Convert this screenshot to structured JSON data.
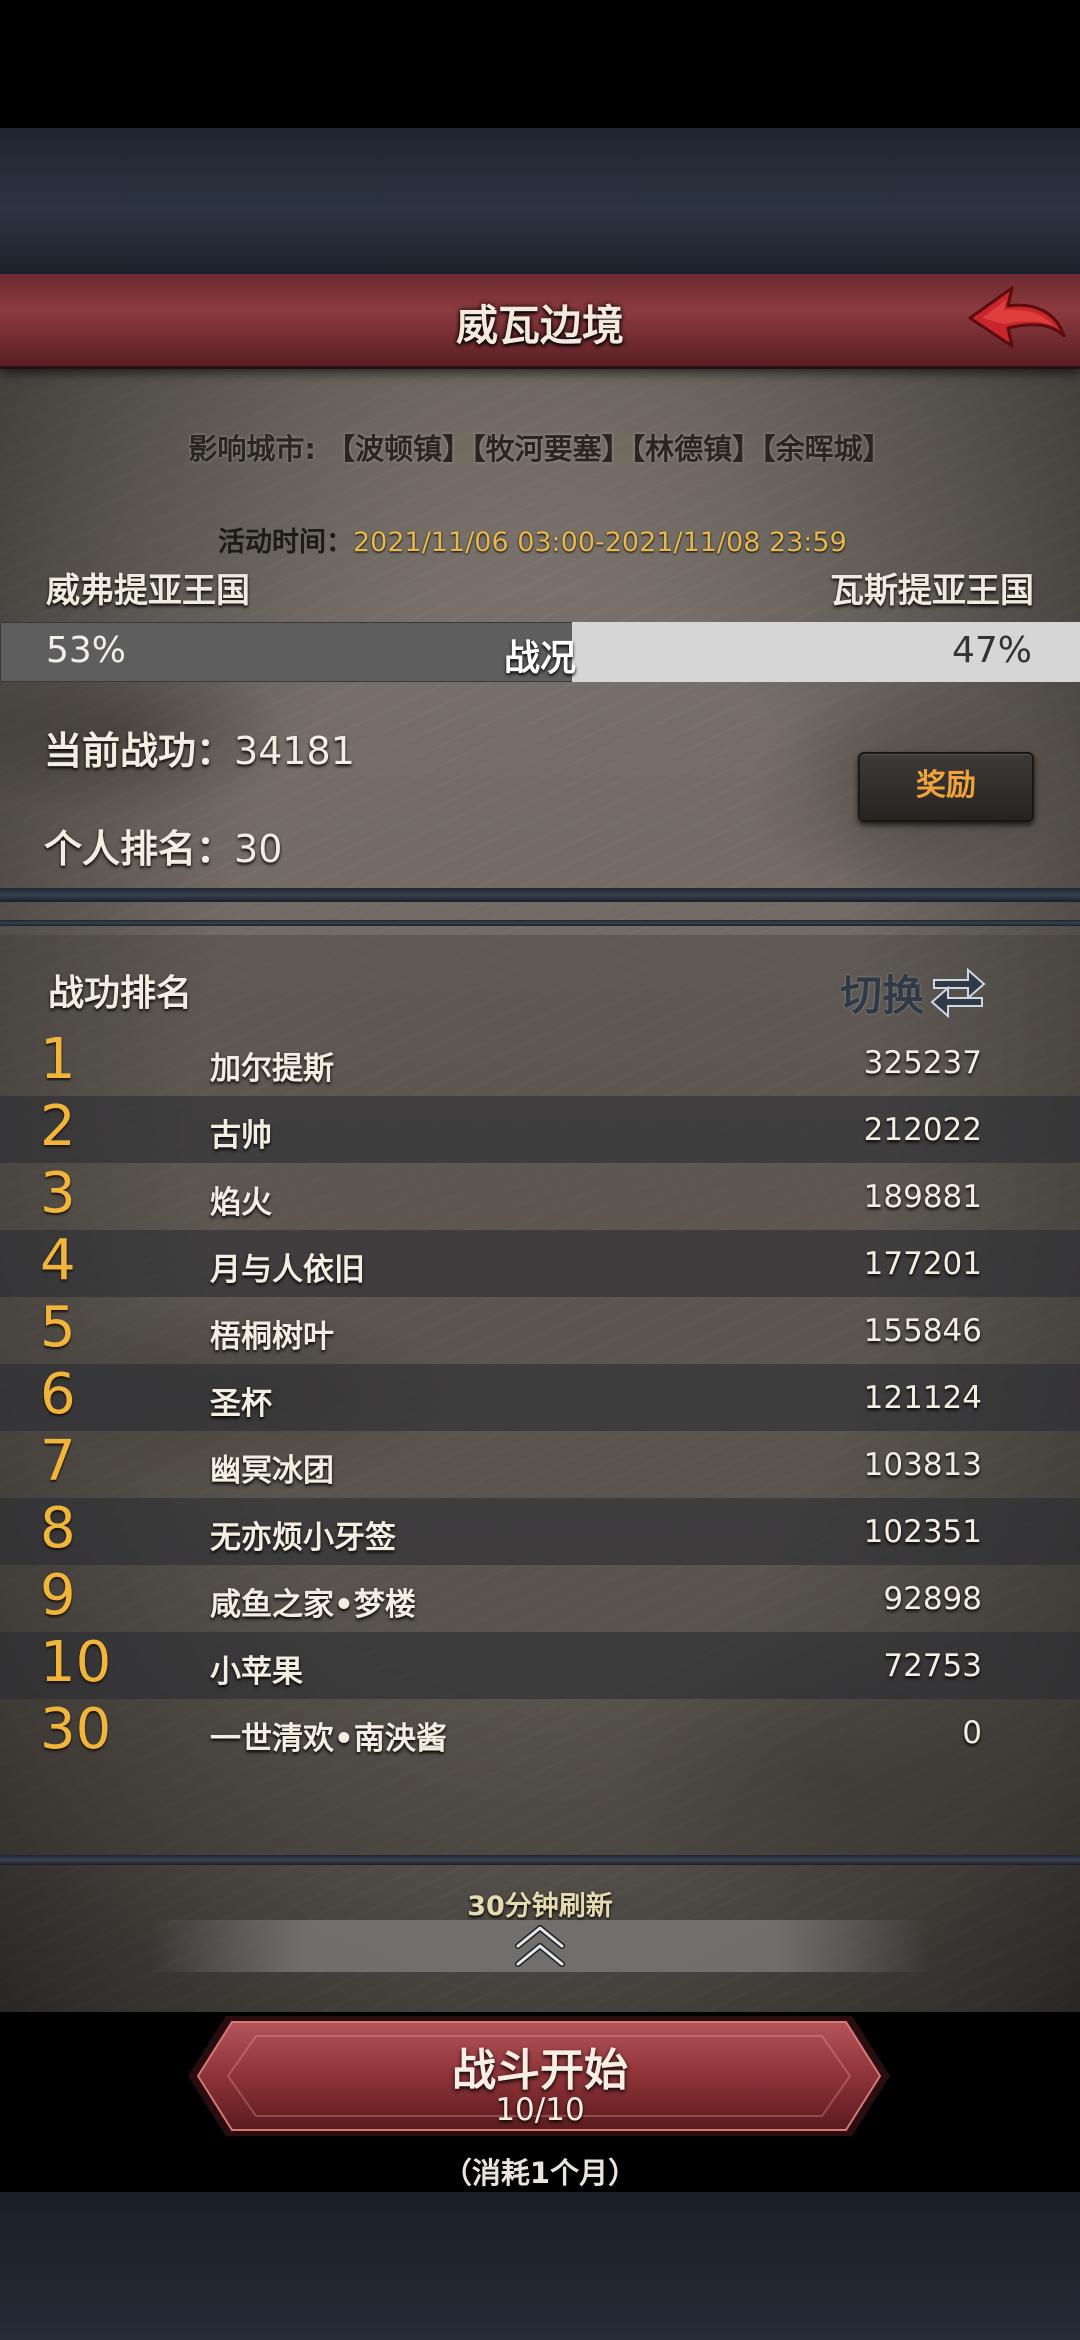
{
  "header": {
    "title": "威瓦边境"
  },
  "info": {
    "cities": "影响城市: 【波顿镇】【牧河要塞】【林德镇】【余晖城】",
    "event_time_label": "活动时间：",
    "event_time_value": "2021/11/06 03:00-2021/11/08 23:59"
  },
  "war": {
    "left_kingdom": "威弗提亚王国",
    "right_kingdom": "瓦斯提亚王国",
    "left_percent": "53%",
    "right_percent": "47%",
    "left_fraction": 0.53,
    "label": "战况",
    "left_color": "#5f5e5e",
    "right_color": "#d6d6d6"
  },
  "stats": {
    "merit_label": "当前战功：",
    "merit_value": "34181",
    "rank_label": "个人排名：",
    "rank_value": "30",
    "reward_button": "奖励"
  },
  "ranking": {
    "title": "战功排名",
    "switch_label": "切换",
    "rows": [
      {
        "rank": "1",
        "name": "加尔提斯",
        "score": "325237"
      },
      {
        "rank": "2",
        "name": "古帅",
        "score": "212022"
      },
      {
        "rank": "3",
        "name": "焰火",
        "score": "189881"
      },
      {
        "rank": "4",
        "name": "月与人依旧",
        "score": "177201"
      },
      {
        "rank": "5",
        "name": "梧桐树叶",
        "score": "155846"
      },
      {
        "rank": "6",
        "name": "圣杯",
        "score": "121124"
      },
      {
        "rank": "7",
        "name": "幽冥冰团",
        "score": "103813"
      },
      {
        "rank": "8",
        "name": "无亦烦小牙签",
        "score": "102351"
      },
      {
        "rank": "9",
        "name": "咸鱼之家•梦楼",
        "score": "92898"
      },
      {
        "rank": "10",
        "name": "小苹果",
        "score": "72753"
      },
      {
        "rank": "30",
        "name": "一世清欢•南泱酱",
        "score": "0"
      }
    ]
  },
  "footer": {
    "refresh_note": "30分钟刷新",
    "battle_button": "战斗开始",
    "battle_count": "10/10",
    "cost_note": "（消耗1个月）"
  },
  "icons": {
    "back": "back-arrow-icon",
    "switch": "swap-arrows-icon",
    "expand": "double-chevron-up-icon"
  },
  "colors": {
    "accent_gold": "#f2b53c",
    "header_red": "#8c3b3f",
    "reward_orange": "#f0a33a"
  }
}
